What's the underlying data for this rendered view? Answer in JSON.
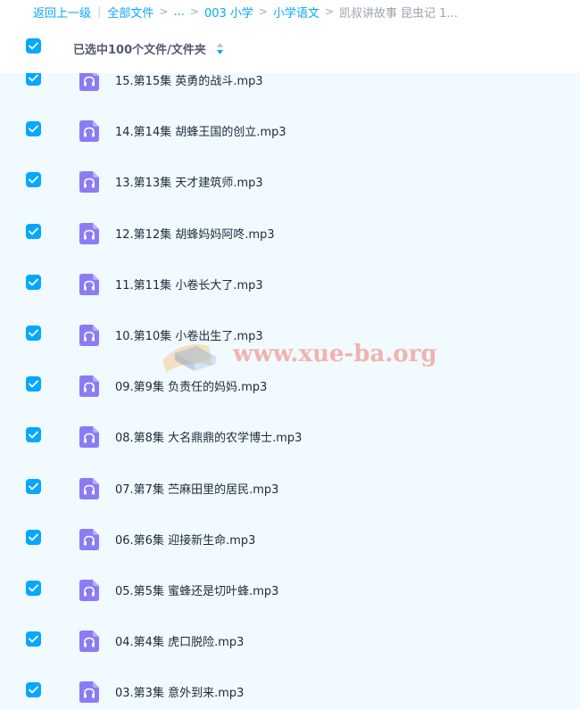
{
  "breadcrumb": {
    "back": "返回上一级",
    "separator_bar": "|",
    "all_files": "全部文件",
    "chevron": ">",
    "ellipsis": "...",
    "folder_1": "003 小学",
    "folder_2": "小学语文",
    "current": "凯叔讲故事 昆虫记 1..."
  },
  "header": {
    "selection_text": "已选中100个文件/文件夹",
    "sort_icon": "sort-up-down-icon"
  },
  "files": [
    {
      "name": "15.第15集 英勇的战斗.mp3",
      "icon": "audio-file-icon",
      "checked": true
    },
    {
      "name": "14.第14集 胡蜂王国的创立.mp3",
      "icon": "audio-file-icon",
      "checked": true
    },
    {
      "name": "13.第13集 天才建筑师.mp3",
      "icon": "audio-file-icon",
      "checked": true
    },
    {
      "name": "12.第12集 胡蜂妈妈阿咚.mp3",
      "icon": "audio-file-icon",
      "checked": true
    },
    {
      "name": "11.第11集 小卷长大了.mp3",
      "icon": "audio-file-icon",
      "checked": true
    },
    {
      "name": "10.第10集 小卷出生了.mp3",
      "icon": "audio-file-icon",
      "checked": true
    },
    {
      "name": "09.第9集 负责任的妈妈.mp3",
      "icon": "audio-file-icon",
      "checked": true
    },
    {
      "name": "08.第8集 大名鼎鼎的农学博士.mp3",
      "icon": "audio-file-icon",
      "checked": true
    },
    {
      "name": "07.第7集 苎麻田里的居民.mp3",
      "icon": "audio-file-icon",
      "checked": true
    },
    {
      "name": "06.第6集 迎接新生命.mp3",
      "icon": "audio-file-icon",
      "checked": true
    },
    {
      "name": "05.第5集 蜜蜂还是切叶蜂.mp3",
      "icon": "audio-file-icon",
      "checked": true
    },
    {
      "name": "04.第4集 虎口脱险.mp3",
      "icon": "audio-file-icon",
      "checked": true
    },
    {
      "name": "03.第3集 意外到来.mp3",
      "icon": "audio-file-icon",
      "checked": true
    }
  ],
  "watermark": {
    "text": "www.xue-ba.org"
  },
  "colors": {
    "accent": "#06a7ff",
    "list_background": "#f1faff",
    "file_icon": "#8b7cf6",
    "watermark": "#f0786e"
  }
}
